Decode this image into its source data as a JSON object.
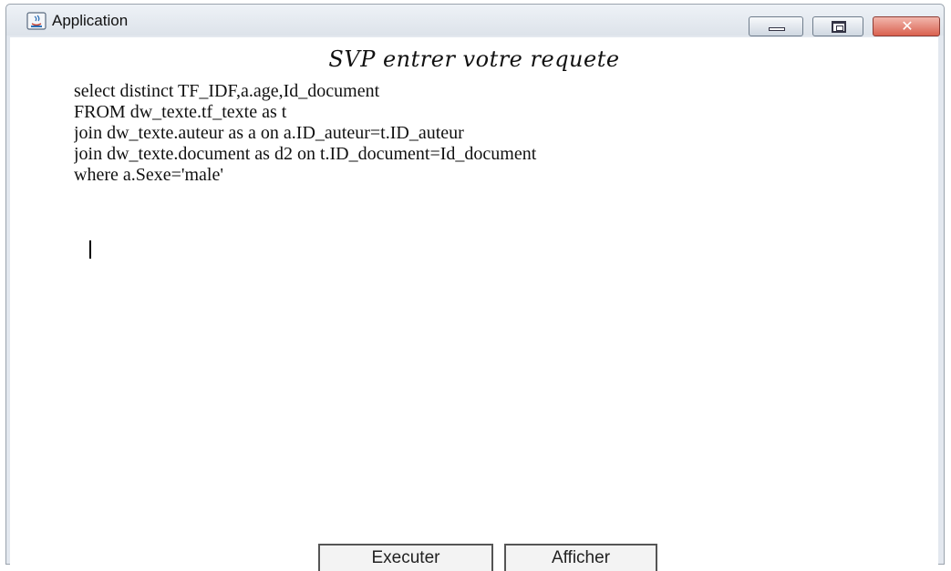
{
  "window": {
    "title": "Application",
    "icon": "java-app-icon",
    "controls": [
      "minimize",
      "maximize",
      "close"
    ],
    "close_glyph": "✕"
  },
  "form": {
    "heading": "SVP entrer votre requete",
    "query_text": "select distinct TF_IDF,a.age,Id_document\nFROM dw_texte.tf_texte as t\njoin dw_texte.auteur as a on a.ID_auteur=t.ID_auteur\njoin dw_texte.document as d2 on t.ID_document=Id_document\nwhere a.Sexe='male'"
  },
  "buttons": {
    "execute_label": "Executer",
    "show_label": "Afficher"
  },
  "colors": {
    "close_button": "#d9614f",
    "title_bar": "#dde3ea"
  }
}
